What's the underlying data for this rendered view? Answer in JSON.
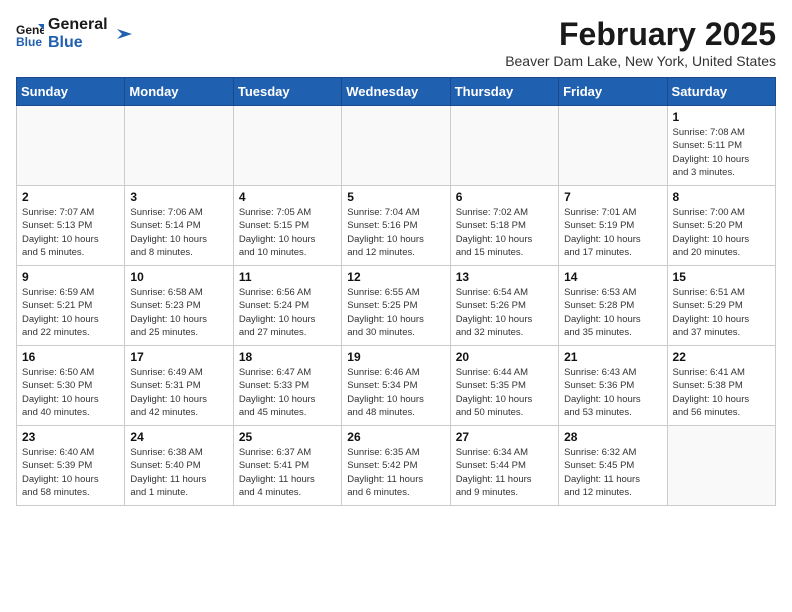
{
  "header": {
    "logo_line1": "General",
    "logo_line2": "Blue",
    "month_title": "February 2025",
    "location": "Beaver Dam Lake, New York, United States"
  },
  "weekdays": [
    "Sunday",
    "Monday",
    "Tuesday",
    "Wednesday",
    "Thursday",
    "Friday",
    "Saturday"
  ],
  "weeks": [
    [
      {
        "day": "",
        "detail": ""
      },
      {
        "day": "",
        "detail": ""
      },
      {
        "day": "",
        "detail": ""
      },
      {
        "day": "",
        "detail": ""
      },
      {
        "day": "",
        "detail": ""
      },
      {
        "day": "",
        "detail": ""
      },
      {
        "day": "1",
        "detail": "Sunrise: 7:08 AM\nSunset: 5:11 PM\nDaylight: 10 hours\nand 3 minutes."
      }
    ],
    [
      {
        "day": "2",
        "detail": "Sunrise: 7:07 AM\nSunset: 5:13 PM\nDaylight: 10 hours\nand 5 minutes."
      },
      {
        "day": "3",
        "detail": "Sunrise: 7:06 AM\nSunset: 5:14 PM\nDaylight: 10 hours\nand 8 minutes."
      },
      {
        "day": "4",
        "detail": "Sunrise: 7:05 AM\nSunset: 5:15 PM\nDaylight: 10 hours\nand 10 minutes."
      },
      {
        "day": "5",
        "detail": "Sunrise: 7:04 AM\nSunset: 5:16 PM\nDaylight: 10 hours\nand 12 minutes."
      },
      {
        "day": "6",
        "detail": "Sunrise: 7:02 AM\nSunset: 5:18 PM\nDaylight: 10 hours\nand 15 minutes."
      },
      {
        "day": "7",
        "detail": "Sunrise: 7:01 AM\nSunset: 5:19 PM\nDaylight: 10 hours\nand 17 minutes."
      },
      {
        "day": "8",
        "detail": "Sunrise: 7:00 AM\nSunset: 5:20 PM\nDaylight: 10 hours\nand 20 minutes."
      }
    ],
    [
      {
        "day": "9",
        "detail": "Sunrise: 6:59 AM\nSunset: 5:21 PM\nDaylight: 10 hours\nand 22 minutes."
      },
      {
        "day": "10",
        "detail": "Sunrise: 6:58 AM\nSunset: 5:23 PM\nDaylight: 10 hours\nand 25 minutes."
      },
      {
        "day": "11",
        "detail": "Sunrise: 6:56 AM\nSunset: 5:24 PM\nDaylight: 10 hours\nand 27 minutes."
      },
      {
        "day": "12",
        "detail": "Sunrise: 6:55 AM\nSunset: 5:25 PM\nDaylight: 10 hours\nand 30 minutes."
      },
      {
        "day": "13",
        "detail": "Sunrise: 6:54 AM\nSunset: 5:26 PM\nDaylight: 10 hours\nand 32 minutes."
      },
      {
        "day": "14",
        "detail": "Sunrise: 6:53 AM\nSunset: 5:28 PM\nDaylight: 10 hours\nand 35 minutes."
      },
      {
        "day": "15",
        "detail": "Sunrise: 6:51 AM\nSunset: 5:29 PM\nDaylight: 10 hours\nand 37 minutes."
      }
    ],
    [
      {
        "day": "16",
        "detail": "Sunrise: 6:50 AM\nSunset: 5:30 PM\nDaylight: 10 hours\nand 40 minutes."
      },
      {
        "day": "17",
        "detail": "Sunrise: 6:49 AM\nSunset: 5:31 PM\nDaylight: 10 hours\nand 42 minutes."
      },
      {
        "day": "18",
        "detail": "Sunrise: 6:47 AM\nSunset: 5:33 PM\nDaylight: 10 hours\nand 45 minutes."
      },
      {
        "day": "19",
        "detail": "Sunrise: 6:46 AM\nSunset: 5:34 PM\nDaylight: 10 hours\nand 48 minutes."
      },
      {
        "day": "20",
        "detail": "Sunrise: 6:44 AM\nSunset: 5:35 PM\nDaylight: 10 hours\nand 50 minutes."
      },
      {
        "day": "21",
        "detail": "Sunrise: 6:43 AM\nSunset: 5:36 PM\nDaylight: 10 hours\nand 53 minutes."
      },
      {
        "day": "22",
        "detail": "Sunrise: 6:41 AM\nSunset: 5:38 PM\nDaylight: 10 hours\nand 56 minutes."
      }
    ],
    [
      {
        "day": "23",
        "detail": "Sunrise: 6:40 AM\nSunset: 5:39 PM\nDaylight: 10 hours\nand 58 minutes."
      },
      {
        "day": "24",
        "detail": "Sunrise: 6:38 AM\nSunset: 5:40 PM\nDaylight: 11 hours\nand 1 minute."
      },
      {
        "day": "25",
        "detail": "Sunrise: 6:37 AM\nSunset: 5:41 PM\nDaylight: 11 hours\nand 4 minutes."
      },
      {
        "day": "26",
        "detail": "Sunrise: 6:35 AM\nSunset: 5:42 PM\nDaylight: 11 hours\nand 6 minutes."
      },
      {
        "day": "27",
        "detail": "Sunrise: 6:34 AM\nSunset: 5:44 PM\nDaylight: 11 hours\nand 9 minutes."
      },
      {
        "day": "28",
        "detail": "Sunrise: 6:32 AM\nSunset: 5:45 PM\nDaylight: 11 hours\nand 12 minutes."
      },
      {
        "day": "",
        "detail": ""
      }
    ]
  ]
}
